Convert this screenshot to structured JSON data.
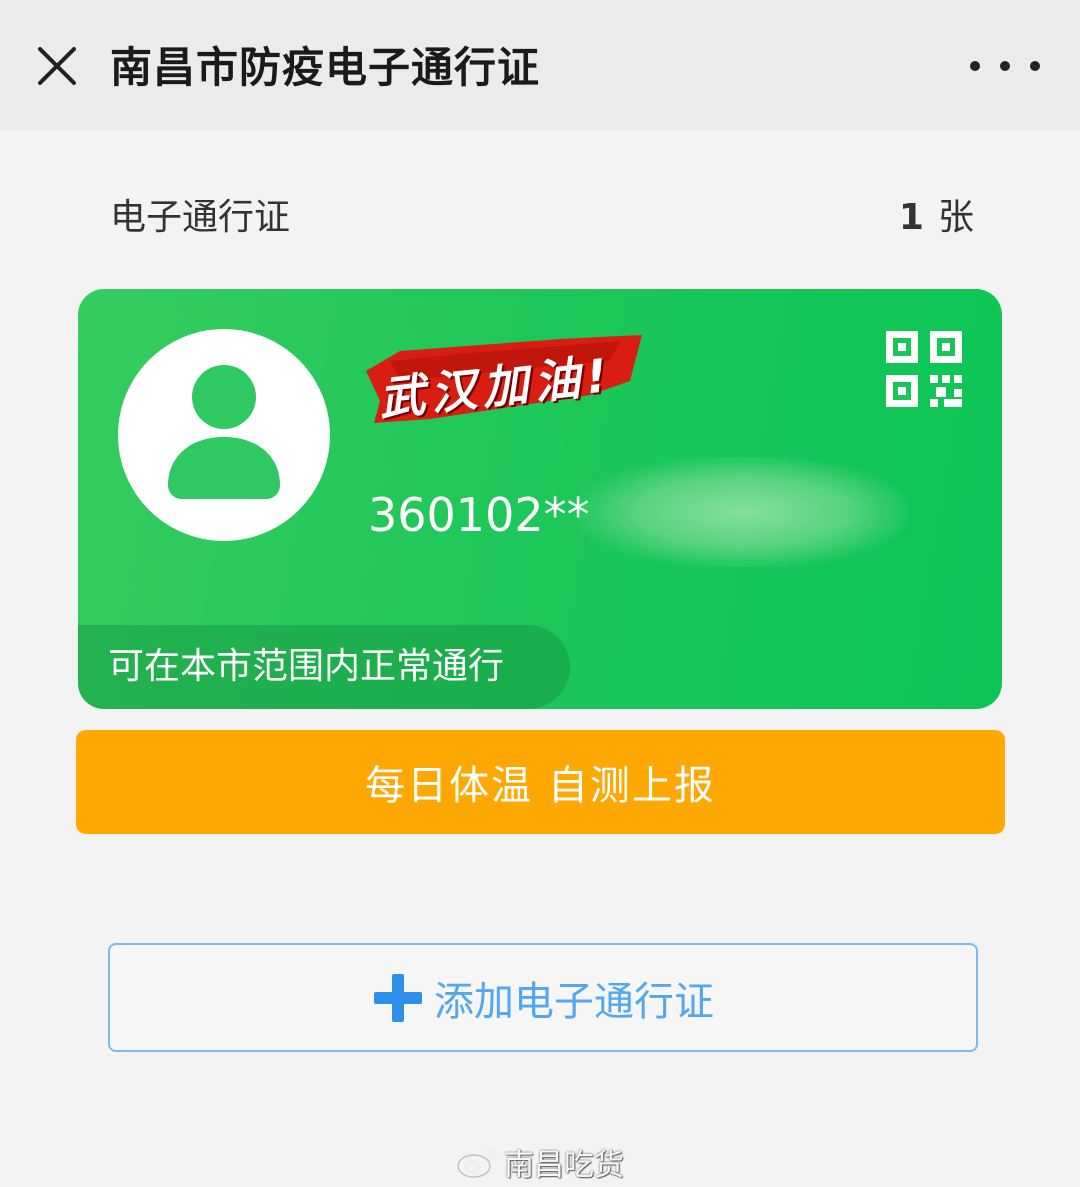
{
  "header": {
    "title": "南昌市防疫电子通行证"
  },
  "section": {
    "label": "电子通行证",
    "count": "1",
    "count_unit": "张"
  },
  "card": {
    "slogan": "武汉加油!",
    "id_number": "360102**",
    "status": "可在本市范围内正常通行",
    "colors": {
      "card_green": "#1fc759",
      "slogan_red": "#d81e12"
    }
  },
  "report_button": {
    "label": "每日体温 自测上报",
    "color": "#ffa703"
  },
  "add_button": {
    "label": "添加电子通行证",
    "color": "#52a7ee"
  },
  "watermark": {
    "text": "南昌吃货"
  },
  "icons": [
    "close-icon",
    "more-icon",
    "avatar-icon",
    "qr-code-icon",
    "plus-icon",
    "weibo-icon"
  ]
}
